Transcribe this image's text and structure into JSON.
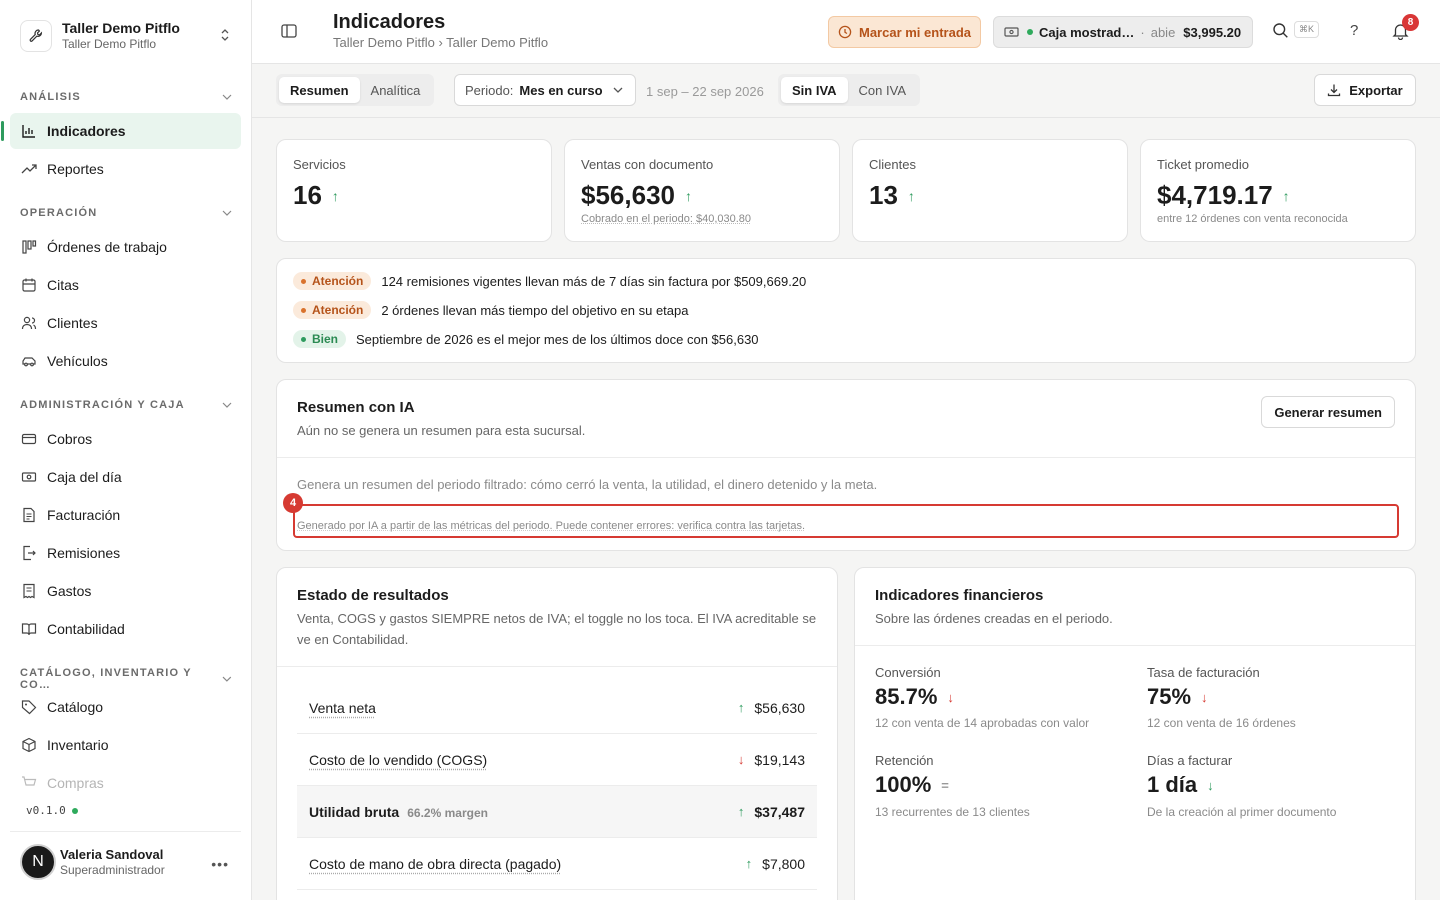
{
  "sidebar": {
    "brand_name": "Taller Demo Pitflo",
    "brand_sub": "Taller Demo Pitflo",
    "sections": {
      "analisis": "ANÁLISIS",
      "operacion": "OPERACIÓN",
      "admin": "ADMINISTRACIÓN Y CAJA",
      "catalogo": "CATÁLOGO, INVENTARIO Y CO…"
    },
    "items": {
      "indicadores": "Indicadores",
      "reportes": "Reportes",
      "ordenes": "Órdenes de trabajo",
      "citas": "Citas",
      "clientes": "Clientes",
      "vehiculos": "Vehículos",
      "cobros": "Cobros",
      "caja": "Caja del día",
      "facturacion": "Facturación",
      "remisiones": "Remisiones",
      "gastos": "Gastos",
      "contabilidad": "Contabilidad",
      "catalogo": "Catálogo",
      "inventario": "Inventario",
      "compras": "Compras"
    },
    "version": "v0.1.0",
    "user": {
      "initial": "N",
      "name": "Valeria Sandoval",
      "role": "Superadministrador"
    }
  },
  "topbar": {
    "title": "Indicadores",
    "breadcrumb": "Taller Demo Pitflo › Taller Demo Pitflo",
    "entrada_label": "Marcar mi entrada",
    "caja_name": "Caja mostrad…",
    "caja_status": "abie",
    "caja_amount": "$3,995.20",
    "kbd": "⌘K",
    "help": "?",
    "notif_count": "8"
  },
  "toolbar": {
    "tab_resumen": "Resumen",
    "tab_analitica": "Analítica",
    "period_label": "Periodo:",
    "period_value": "Mes en curso",
    "date_range": "1 sep – 22 sep 2026",
    "iva_off": "Sin IVA",
    "iva_on": "Con IVA",
    "export_label": "Exportar"
  },
  "kpis": [
    {
      "label": "Servicios",
      "value": "16",
      "note": ""
    },
    {
      "label": "Ventas con documento",
      "value": "$56,630",
      "note": "Cobrado en el periodo: $40,030.80"
    },
    {
      "label": "Clientes",
      "value": "13",
      "note": ""
    },
    {
      "label": "Ticket promedio",
      "value": "$4,719.17",
      "note": "entre 12 órdenes con venta reconocida"
    }
  ],
  "alerts": [
    {
      "badge": "Atención",
      "text": "124 remisiones vigentes llevan más de 7 días sin factura por $509,669.20"
    },
    {
      "badge": "Atención",
      "text": "2 órdenes llevan más tiempo del objetivo en su etapa"
    },
    {
      "badge": "Bien",
      "text": "Septiembre de 2026 es el mejor mes de los últimos doce con $56,630"
    }
  ],
  "ai": {
    "title": "Resumen con IA",
    "subtitle": "Aún no se genera un resumen para esta sucursal.",
    "button": "Generar resumen",
    "description": "Genera un resumen del periodo filtrado: cómo cerró la venta, la utilidad, el dinero detenido y la meta.",
    "disclaimer": "Generado por IA a partir de las métricas del periodo. Puede contener errores: verifica contra las tarjetas.",
    "hint_number": "4"
  },
  "resultados": {
    "title": "Estado de resultados",
    "subtitle": "Venta, COGS y gastos SIEMPRE netos de IVA; el toggle no los toca. El IVA acreditable se ve en Contabilidad.",
    "rows": [
      {
        "label": "Venta neta",
        "value": "$56,630",
        "margin": ""
      },
      {
        "label": "Costo de lo vendido (COGS)",
        "value": "$19,143",
        "margin": ""
      },
      {
        "label": "Utilidad bruta",
        "value": "$37,487",
        "margin": "66.2% margen"
      },
      {
        "label": "Costo de mano de obra directa (pagado)",
        "value": "$7,800",
        "margin": ""
      }
    ]
  },
  "financieros": {
    "title": "Indicadores financieros",
    "subtitle": "Sobre las órdenes creadas en el periodo.",
    "items": [
      {
        "label": "Conversión",
        "value": "85.7%",
        "note": "12 con venta de 14 aprobadas con valor"
      },
      {
        "label": "Tasa de facturación",
        "value": "75%",
        "note": "12 con venta de 16 órdenes"
      },
      {
        "label": "Retención",
        "value": "100%",
        "note": "13 recurrentes de 13 clientes"
      },
      {
        "label": "Días a facturar",
        "value": "1 día",
        "note": "De la creación al primer documento"
      }
    ]
  },
  "colors": {
    "accent_green": "#2e9b5e",
    "warn_orange": "#b5531a",
    "alert_red": "#d63a32"
  }
}
